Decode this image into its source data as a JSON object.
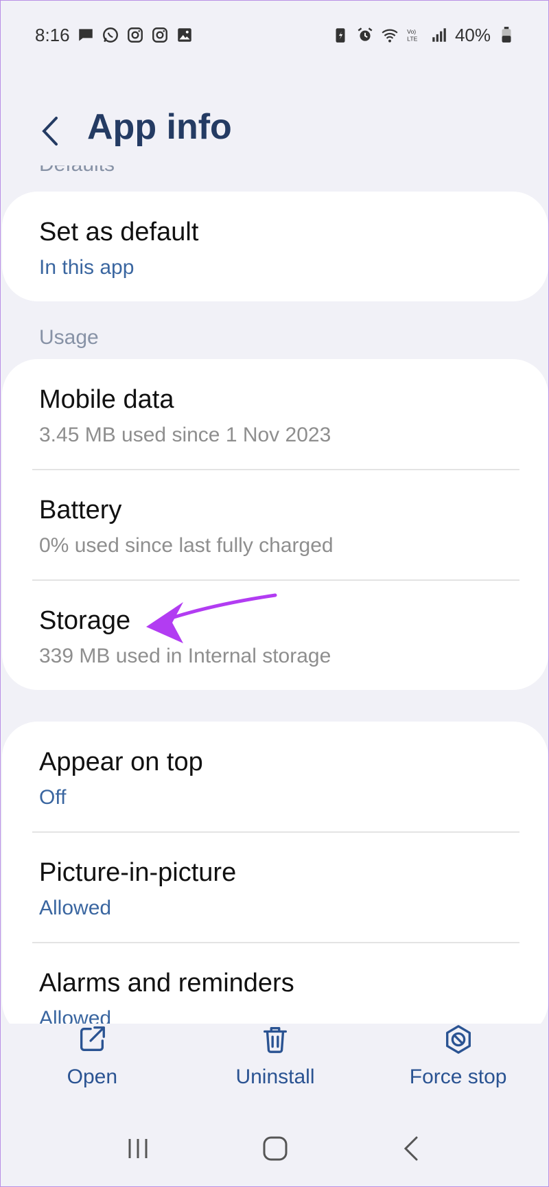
{
  "status_bar": {
    "time": "8:16",
    "battery": "40%",
    "left_icons": [
      "chat-icon",
      "whatsapp-icon",
      "instagram-icon",
      "instagram-icon",
      "gallery-icon"
    ],
    "right_icons": [
      "battery-saver-icon",
      "alarm-icon",
      "wifi-icon",
      "volte-icon",
      "signal-icon",
      "battery-icon"
    ]
  },
  "header": {
    "title": "App info"
  },
  "sections": {
    "defaults_header": "Defaults",
    "usage_header": "Usage"
  },
  "defaults_items": [
    {
      "title": "Set as default",
      "subtitle": "In this app"
    }
  ],
  "usage_items": [
    {
      "title": "Mobile data",
      "subtitle": "3.45 MB used since 1 Nov 2023"
    },
    {
      "title": "Battery",
      "subtitle": "0% used since last fully charged"
    },
    {
      "title": "Storage",
      "subtitle": "339 MB used in Internal storage"
    }
  ],
  "other_items": [
    {
      "title": "Appear on top",
      "subtitle": "Off"
    },
    {
      "title": "Picture-in-picture",
      "subtitle": "Allowed"
    },
    {
      "title": "Alarms and reminders",
      "subtitle": "Allowed"
    }
  ],
  "actions": {
    "open": "Open",
    "uninstall": "Uninstall",
    "force_stop": "Force stop"
  },
  "colors": {
    "accent": "#2a5392",
    "annotation_arrow": "#b23cf2",
    "background": "#f1f1f7"
  }
}
